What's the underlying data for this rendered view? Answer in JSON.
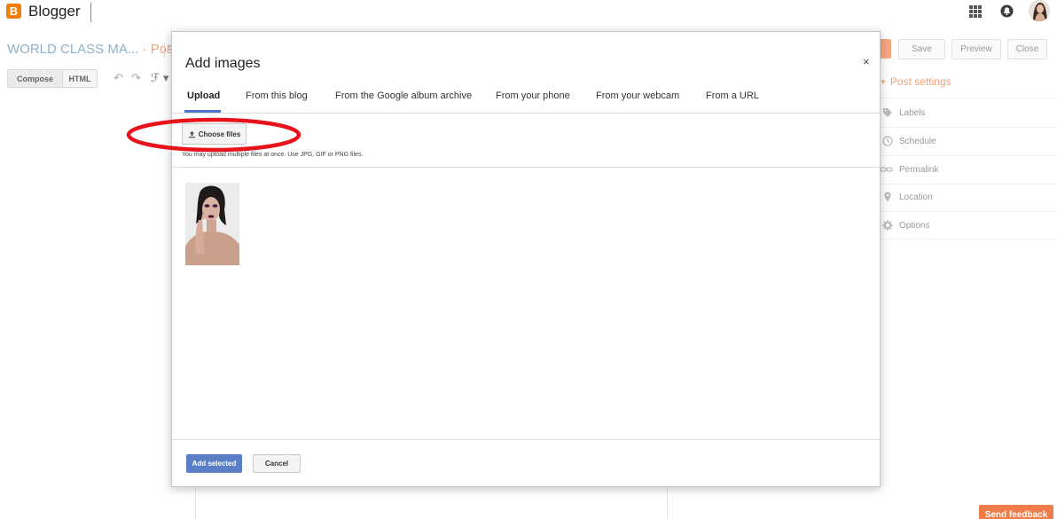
{
  "app": {
    "logo_letter": "B",
    "name": "Blogger"
  },
  "editor": {
    "post_title": "WORLD CLASS MA...",
    "post_crumb": "· Post",
    "post_tail": "P",
    "buttons": {
      "save": "Save",
      "preview": "Preview",
      "close": "Close"
    },
    "modes": {
      "compose": "Compose",
      "html": "HTML"
    },
    "toolbar_glyphs": {
      "undo": "↶",
      "redo": "↷",
      "font": "ℱ ▾"
    }
  },
  "post_settings": {
    "heading": "Post settings",
    "items": [
      {
        "label": "Labels",
        "icon": "tag-icon"
      },
      {
        "label": "Schedule",
        "icon": "clock-icon"
      },
      {
        "label": "Permalink",
        "icon": "link-icon"
      },
      {
        "label": "Location",
        "icon": "pin-icon"
      },
      {
        "label": "Options",
        "icon": "gear-icon"
      }
    ]
  },
  "dialog": {
    "title": "Add images",
    "close_glyph": "×",
    "tabs": [
      {
        "label": "Upload",
        "active": true
      },
      {
        "label": "From this blog",
        "active": false
      },
      {
        "label": "From the Google album archive",
        "active": false
      },
      {
        "label": "From your phone",
        "active": false
      },
      {
        "label": "From your webcam",
        "active": false
      },
      {
        "label": "From a URL",
        "active": false
      }
    ],
    "choose_files": "Choose files",
    "hint": "You may upload multiple files at once. Use JPG, GIF or PNG files.",
    "add_selected": "Add selected",
    "cancel": "Cancel"
  },
  "feedback": "Send feedback",
  "colors": {
    "blogger_orange": "#f57d00",
    "accent_blue": "#5b7fc6",
    "tab_underline": "#4c74c9",
    "annotation_red": "#e8121b",
    "feedback_orange": "#f07b4b"
  }
}
